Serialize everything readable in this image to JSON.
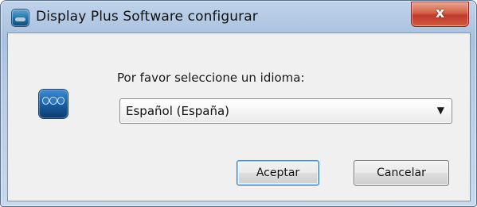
{
  "window": {
    "title": "Display Plus Software configurar",
    "close_glyph": "x"
  },
  "dialog": {
    "prompt": "Por favor seleccione un idioma:",
    "language_select": {
      "selected": "Español (España)",
      "arrow_glyph": "▼"
    },
    "buttons": {
      "ok": "Aceptar",
      "cancel": "Cancelar"
    }
  },
  "icons": {
    "title_icon": "app-icon",
    "app_icon": "display-plus-logo-icon"
  },
  "colors": {
    "frame": "#b6cbe4",
    "client_bg": "#f0f0f0",
    "close_button": "#c0392b",
    "primary_button_border": "#3c7fb1"
  }
}
